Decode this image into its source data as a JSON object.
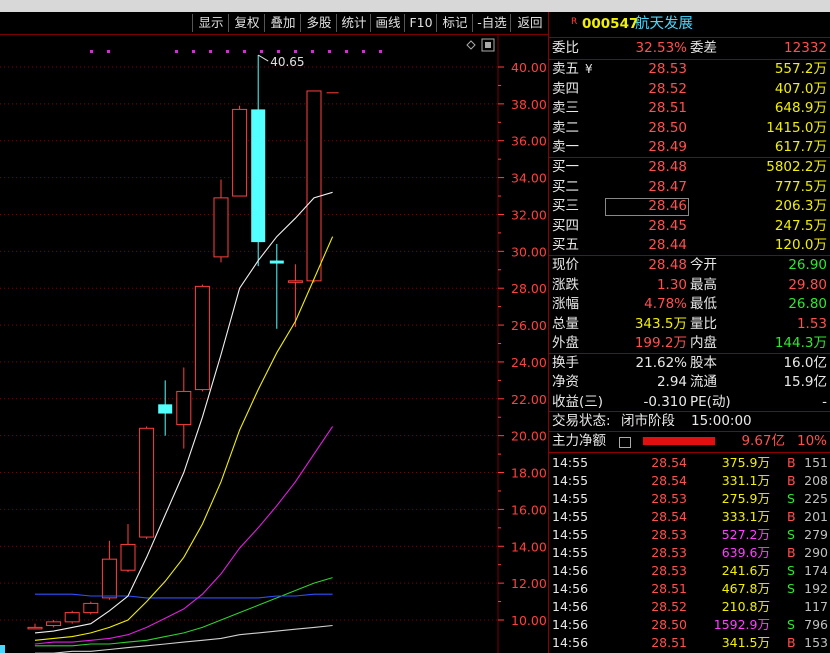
{
  "toolbar": {
    "buttons": [
      "显示",
      "复权",
      "叠加",
      "多股",
      "统计",
      "画线",
      "F10",
      "标记",
      "-自选",
      "返回"
    ]
  },
  "chart": {
    "price_axis": [
      "40.00",
      "38.00",
      "36.00",
      "34.00",
      "32.00",
      "30.00",
      "28.00",
      "26.00",
      "24.00",
      "22.00",
      "20.00",
      "18.00",
      "16.00",
      "14.00",
      "12.00",
      "10.00"
    ],
    "high_marker": "40.65",
    "candles": [
      {
        "o": 9.6,
        "c": 9.6,
        "h": 9.8,
        "l": 9.5
      },
      {
        "o": 9.7,
        "c": 9.9,
        "h": 10.0,
        "l": 9.6
      },
      {
        "o": 9.9,
        "c": 10.4,
        "h": 10.5,
        "l": 9.8
      },
      {
        "o": 10.4,
        "c": 10.9,
        "h": 11.0,
        "l": 10.3
      },
      {
        "o": 11.2,
        "c": 13.3,
        "h": 14.3,
        "l": 11.1
      },
      {
        "o": 12.7,
        "c": 14.1,
        "h": 15.2,
        "l": 12.6
      },
      {
        "o": 14.5,
        "c": 20.4,
        "h": 20.5,
        "l": 14.4
      },
      {
        "o": 21.7,
        "c": 21.2,
        "h": 23.0,
        "l": 20.0
      },
      {
        "o": 20.6,
        "c": 22.4,
        "h": 23.7,
        "l": 19.3
      },
      {
        "o": 22.5,
        "c": 28.1,
        "h": 28.2,
        "l": 22.4
      },
      {
        "o": 29.7,
        "c": 32.9,
        "h": 33.9,
        "l": 29.4
      },
      {
        "o": 33.0,
        "c": 37.7,
        "h": 37.9,
        "l": 33.0
      },
      {
        "o": 37.7,
        "c": 30.5,
        "h": 40.65,
        "l": 29.2
      },
      {
        "o": 29.5,
        "c": 29.5,
        "h": 30.4,
        "l": 25.8
      },
      {
        "o": 28.4,
        "c": 28.4,
        "h": 29.3,
        "l": 25.9
      },
      {
        "o": 28.4,
        "c": 38.7,
        "h": 38.7,
        "l": 28.3
      },
      {
        "o": 38.6,
        "c": 38.6,
        "h": 38.6,
        "l": 38.6
      }
    ],
    "ma_white": [
      9.3,
      9.4,
      9.6,
      9.8,
      10.5,
      11.3,
      13.4,
      15.7,
      18.0,
      21.0,
      24.4,
      28.0,
      29.5,
      30.8,
      31.8,
      32.9,
      33.2
    ],
    "ma_yellow": [
      8.9,
      9.0,
      9.1,
      9.3,
      9.6,
      10.0,
      11.0,
      12.1,
      13.4,
      15.2,
      17.5,
      20.3,
      22.5,
      24.5,
      26.2,
      28.5,
      30.8
    ],
    "ma_magenta": [
      8.7,
      8.8,
      8.8,
      8.9,
      9.0,
      9.2,
      9.6,
      10.1,
      10.6,
      11.4,
      12.5,
      13.9,
      15.0,
      16.2,
      17.5,
      19.0,
      20.5
    ],
    "ma_green": [
      8.6,
      8.6,
      8.6,
      8.7,
      8.7,
      8.8,
      8.9,
      9.1,
      9.3,
      9.6,
      10.0,
      10.4,
      10.8,
      11.2,
      11.6,
      12.0,
      12.3
    ],
    "ma_blue": [
      11.4,
      11.4,
      11.4,
      11.3,
      11.3,
      11.3,
      11.2,
      11.2,
      11.2,
      11.2,
      11.2,
      11.2,
      11.2,
      11.3,
      11.3,
      11.4,
      11.4
    ],
    "ma_gray": [
      8.2,
      8.2,
      8.3,
      8.3,
      8.4,
      8.5,
      8.6,
      8.7,
      8.8,
      8.9,
      9.0,
      9.2,
      9.3,
      9.4,
      9.5,
      9.6,
      9.7
    ]
  },
  "quote": {
    "flag": "R",
    "code": "000547",
    "name": "航天发展",
    "weibi_label": "委比",
    "weibi_value": "32.53%",
    "weicha_label": "委差",
    "weicha_value": "12332",
    "asks": [
      {
        "label": "卖五",
        "price": "28.53",
        "vol": "557.2万"
      },
      {
        "label": "卖四",
        "price": "28.52",
        "vol": "407.0万"
      },
      {
        "label": "卖三",
        "price": "28.51",
        "vol": "648.9万"
      },
      {
        "label": "卖二",
        "price": "28.50",
        "vol": "1415.0万"
      },
      {
        "label": "卖一",
        "price": "28.49",
        "vol": "617.7万"
      }
    ],
    "ask_currency": "¥",
    "bids": [
      {
        "label": "买一",
        "price": "28.48",
        "vol": "5802.2万"
      },
      {
        "label": "买二",
        "price": "28.47",
        "vol": "777.5万"
      },
      {
        "label": "买三",
        "price": "28.46",
        "vol": "206.3万"
      },
      {
        "label": "买四",
        "price": "28.45",
        "vol": "247.5万"
      },
      {
        "label": "买五",
        "price": "28.44",
        "vol": "120.0万"
      }
    ],
    "stats": [
      {
        "l1": "现价",
        "v1": "28.48",
        "c1": "red",
        "l2": "今开",
        "v2": "26.90",
        "c2": "green"
      },
      {
        "l1": "涨跌",
        "v1": "1.30",
        "c1": "red",
        "l2": "最高",
        "v2": "29.80",
        "c2": "red"
      },
      {
        "l1": "涨幅",
        "v1": "4.78%",
        "c1": "red",
        "l2": "最低",
        "v2": "26.80",
        "c2": "green"
      },
      {
        "l1": "总量",
        "v1": "343.5万",
        "c1": "yellow",
        "l2": "量比",
        "v2": "1.53",
        "c2": "red"
      },
      {
        "l1": "外盘",
        "v1": "199.2万",
        "c1": "red",
        "l2": "内盘",
        "v2": "144.3万",
        "c2": "green"
      }
    ],
    "stats2": [
      {
        "l1": "换手",
        "v1": "21.62%",
        "l2": "股本",
        "v2": "16.0亿"
      },
      {
        "l1": "净资",
        "v1": "2.94",
        "l2": "流通",
        "v2": "15.9亿"
      },
      {
        "l1": "收益(三)",
        "v1": "-0.310",
        "l2": "PE(动)",
        "v2": "-"
      }
    ],
    "trade_status_label": "交易状态:",
    "trade_status_value": "闭市阶段",
    "trade_status_time": "15:00:00",
    "main_flow_label": "主力净额",
    "main_flow_value": "9.67亿",
    "main_flow_pct": "10%",
    "main_flow_ratio": 0.55
  },
  "ticks": [
    {
      "t": "14:55",
      "p": "28.54",
      "v": "375.9万",
      "vc": "yellow",
      "s": "B",
      "n": "151"
    },
    {
      "t": "14:55",
      "p": "28.54",
      "v": "331.1万",
      "vc": "yellow",
      "s": "B",
      "n": "208"
    },
    {
      "t": "14:55",
      "p": "28.53",
      "v": "275.9万",
      "vc": "yellow",
      "s": "S",
      "n": "225"
    },
    {
      "t": "14:55",
      "p": "28.54",
      "v": "333.1万",
      "vc": "yellow",
      "s": "B",
      "n": "201"
    },
    {
      "t": "14:55",
      "p": "28.53",
      "v": "527.2万",
      "vc": "magenta",
      "s": "S",
      "n": "279"
    },
    {
      "t": "14:55",
      "p": "28.53",
      "v": "639.6万",
      "vc": "magenta",
      "s": "B",
      "n": "290"
    },
    {
      "t": "14:56",
      "p": "28.53",
      "v": "241.6万",
      "vc": "yellow",
      "s": "S",
      "n": "174"
    },
    {
      "t": "14:56",
      "p": "28.51",
      "v": "467.8万",
      "vc": "yellow",
      "s": "S",
      "n": "192"
    },
    {
      "t": "14:56",
      "p": "28.52",
      "v": "210.8万",
      "vc": "yellow",
      "s": "",
      "n": "117"
    },
    {
      "t": "14:56",
      "p": "28.50",
      "v": "1592.9万",
      "vc": "magenta",
      "s": "S",
      "n": "796"
    },
    {
      "t": "14:56",
      "p": "28.51",
      "v": "341.5万",
      "vc": "yellow",
      "s": "B",
      "n": "153"
    }
  ],
  "colors": {
    "up": "#ff4040",
    "down": "#54ffff",
    "grid": "#7a0000"
  }
}
